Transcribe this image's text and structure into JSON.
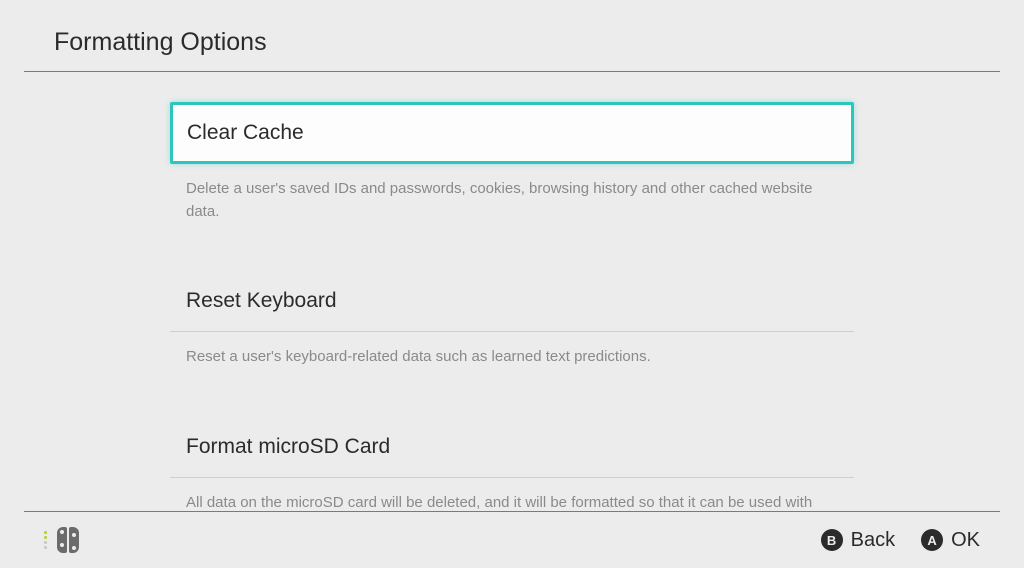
{
  "header": {
    "title": "Formatting Options"
  },
  "options": [
    {
      "label": "Clear Cache",
      "description": "Delete a user's saved IDs and passwords, cookies, browsing history and other cached website data."
    },
    {
      "label": "Reset Keyboard",
      "description": "Reset a user's keyboard-related data such as learned text predictions."
    },
    {
      "label": "Format microSD Card",
      "description": "All data on the microSD card will be deleted, and it will be formatted so that it can be used with this console."
    }
  ],
  "footer": {
    "back": {
      "glyph": "B",
      "label": "Back"
    },
    "ok": {
      "glyph": "A",
      "label": "OK"
    }
  }
}
